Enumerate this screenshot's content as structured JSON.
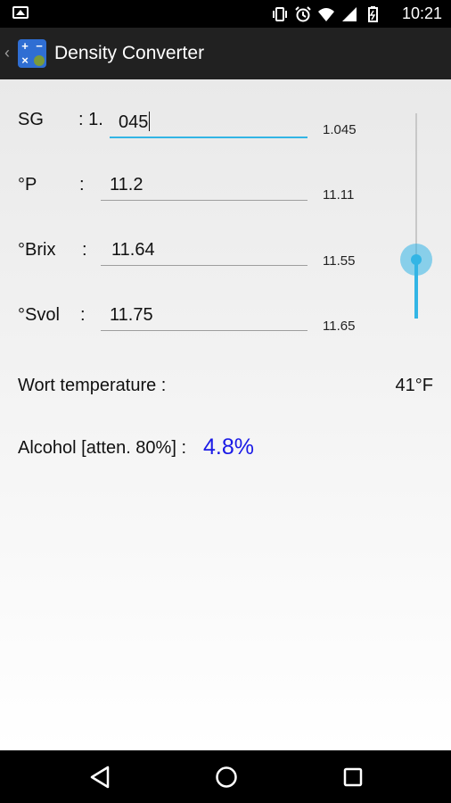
{
  "status_bar": {
    "time": "10:21",
    "icons": [
      "image-icon",
      "vibrate-icon",
      "alarm-icon",
      "wifi-icon",
      "signal-icon",
      "battery-charging-icon"
    ]
  },
  "action_bar": {
    "back_icon": "‹",
    "title": "Density Converter"
  },
  "form": {
    "rows": [
      {
        "label": "SG",
        "colon": ":",
        "value": "1.  045",
        "computed": "1.045"
      },
      {
        "label": "°P",
        "colon": ":",
        "value": "11.2",
        "computed": "11.11"
      },
      {
        "label": "°Brix",
        "colon": ":",
        "value": "11.64",
        "computed": "11.55"
      },
      {
        "label": "°Svol",
        "colon": ":",
        "value": "11.75",
        "computed": "11.65"
      }
    ],
    "sg_prefix": ": 1.",
    "sg_value": "045",
    "temperature": {
      "label": "Wort temperature :",
      "value": "41°F"
    },
    "alcohol": {
      "label": "Alcohol [atten. 80%] :",
      "value": "4.8%",
      "color": "#1a1ae6"
    },
    "slider": {
      "level": 0.29,
      "accent": "#33b5e5"
    }
  },
  "nav_bar": {
    "icons": [
      "back-icon",
      "home-icon",
      "recents-icon"
    ]
  }
}
